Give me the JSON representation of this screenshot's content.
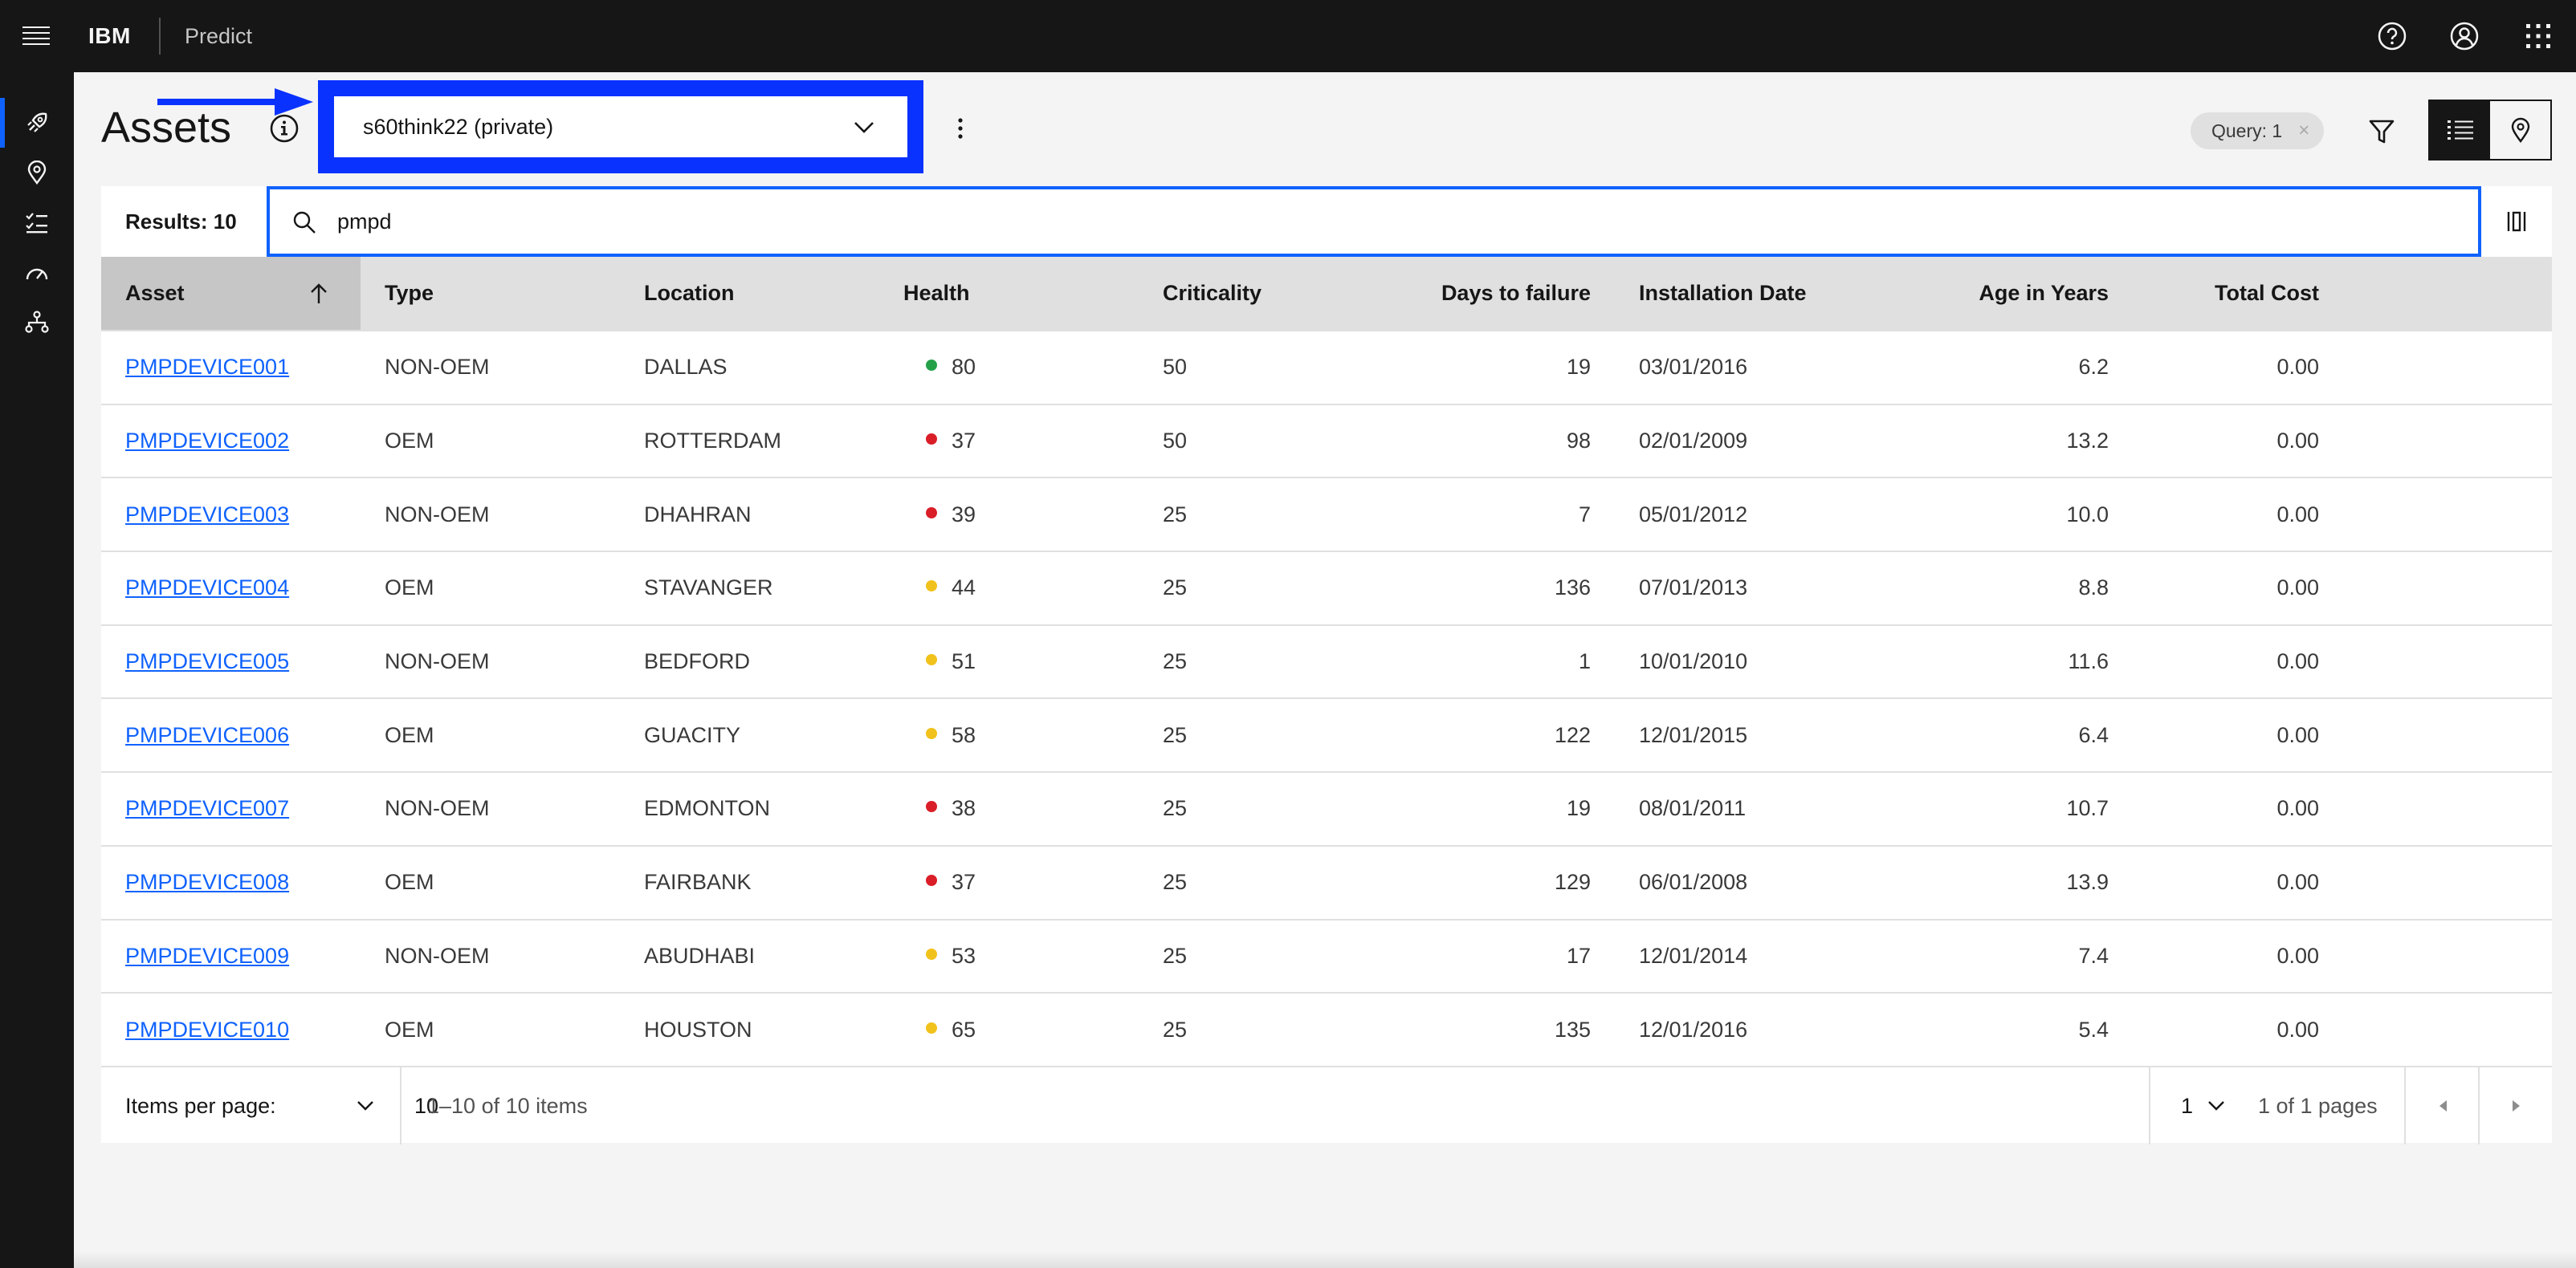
{
  "header": {
    "brand": "IBM",
    "product": "Predict"
  },
  "page": {
    "title": "Assets",
    "group_selector_value": "s60think22 (private)",
    "query_tag": "Query: 1",
    "query_tag_close": "×"
  },
  "toolbar": {
    "results_label": "Results: 10",
    "search_value": "pmpd"
  },
  "table": {
    "columns": [
      "Asset",
      "Type",
      "Location",
      "Health",
      "Criticality",
      "Days to failure",
      "Installation Date",
      "Age in Years",
      "Total Cost"
    ],
    "sorted_column": "Asset",
    "rows": [
      {
        "asset": "PMPDEVICE001",
        "type": "NON-OEM",
        "location": "DALLAS",
        "health": "80",
        "health_status": "green",
        "criticality": "50",
        "days": "19",
        "install": "03/01/2016",
        "age": "6.2",
        "cost": "0.00"
      },
      {
        "asset": "PMPDEVICE002",
        "type": "OEM",
        "location": "ROTTERDAM",
        "health": "37",
        "health_status": "red",
        "criticality": "50",
        "days": "98",
        "install": "02/01/2009",
        "age": "13.2",
        "cost": "0.00"
      },
      {
        "asset": "PMPDEVICE003",
        "type": "NON-OEM",
        "location": "DHAHRAN",
        "health": "39",
        "health_status": "red",
        "criticality": "25",
        "days": "7",
        "install": "05/01/2012",
        "age": "10.0",
        "cost": "0.00"
      },
      {
        "asset": "PMPDEVICE004",
        "type": "OEM",
        "location": "STAVANGER",
        "health": "44",
        "health_status": "yellow",
        "criticality": "25",
        "days": "136",
        "install": "07/01/2013",
        "age": "8.8",
        "cost": "0.00"
      },
      {
        "asset": "PMPDEVICE005",
        "type": "NON-OEM",
        "location": "BEDFORD",
        "health": "51",
        "health_status": "yellow",
        "criticality": "25",
        "days": "1",
        "install": "10/01/2010",
        "age": "11.6",
        "cost": "0.00"
      },
      {
        "asset": "PMPDEVICE006",
        "type": "OEM",
        "location": "GUACITY",
        "health": "58",
        "health_status": "yellow",
        "criticality": "25",
        "days": "122",
        "install": "12/01/2015",
        "age": "6.4",
        "cost": "0.00"
      },
      {
        "asset": "PMPDEVICE007",
        "type": "NON-OEM",
        "location": "EDMONTON",
        "health": "38",
        "health_status": "red",
        "criticality": "25",
        "days": "19",
        "install": "08/01/2011",
        "age": "10.7",
        "cost": "0.00"
      },
      {
        "asset": "PMPDEVICE008",
        "type": "OEM",
        "location": "FAIRBANK",
        "health": "37",
        "health_status": "red",
        "criticality": "25",
        "days": "129",
        "install": "06/01/2008",
        "age": "13.9",
        "cost": "0.00"
      },
      {
        "asset": "PMPDEVICE009",
        "type": "NON-OEM",
        "location": "ABUDHABI",
        "health": "53",
        "health_status": "yellow",
        "criticality": "25",
        "days": "17",
        "install": "12/01/2014",
        "age": "7.4",
        "cost": "0.00"
      },
      {
        "asset": "PMPDEVICE010",
        "type": "OEM",
        "location": "HOUSTON",
        "health": "65",
        "health_status": "yellow",
        "criticality": "25",
        "days": "135",
        "install": "12/01/2016",
        "age": "5.4",
        "cost": "0.00"
      }
    ]
  },
  "pagination": {
    "items_per_page_label": "Items per page:",
    "items_per_page_value": "10",
    "range_text": "1–10 of 10 items",
    "page_value": "1",
    "pages_text": "1 of 1 pages"
  },
  "colors": {
    "header_bg": "#161616",
    "accent": "#0f62fe",
    "highlight_box": "#0a32ff",
    "health_green": "#24a148",
    "health_red": "#da1e28",
    "health_yellow": "#f1c21b"
  },
  "icons": [
    "hamburger-menu-icon",
    "help-icon",
    "user-avatar-icon",
    "app-switcher-icon",
    "rocket-icon",
    "location-pin-icon",
    "checklist-icon",
    "gauge-icon",
    "hierarchy-icon",
    "info-icon",
    "chevron-down-icon",
    "overflow-menu-icon",
    "filter-icon",
    "list-view-icon",
    "map-view-icon",
    "search-icon",
    "column-settings-icon",
    "sort-ascending-icon",
    "caret-left-icon",
    "caret-right-icon"
  ]
}
